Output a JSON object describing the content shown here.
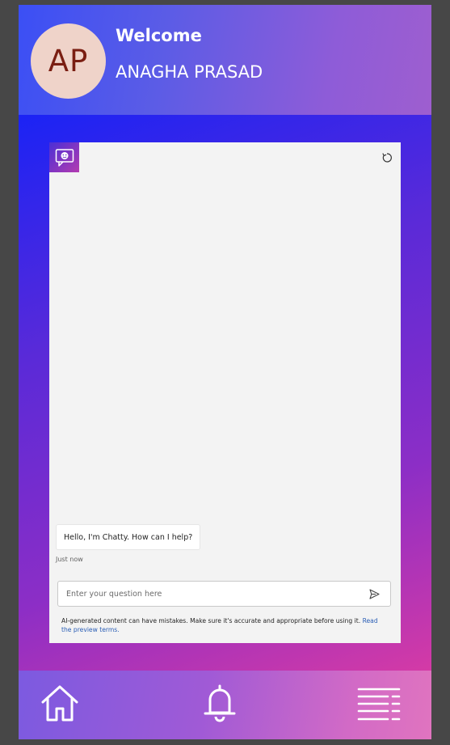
{
  "header": {
    "avatar_initials": "AP",
    "welcome": "Welcome",
    "username": "ANAGHA PRASAD"
  },
  "chat": {
    "bot_icon": "chat-bot-icon",
    "refresh_icon": "refresh-icon",
    "message": "Hello, I'm Chatty. How can I help?",
    "timestamp": "Just now",
    "input_placeholder": "Enter your question here",
    "send_icon": "send-icon",
    "disclaimer": "AI-generated content can have mistakes. Make sure it's accurate and appropriate before using it.",
    "terms_link": "Read the preview terms."
  },
  "nav": {
    "items": [
      {
        "icon": "home-icon"
      },
      {
        "icon": "bell-icon"
      },
      {
        "icon": "menu-icon"
      }
    ]
  },
  "colors": {
    "avatar_bg": "#efd3c9",
    "avatar_text": "#7a1e12",
    "link": "#2b5eb5"
  }
}
